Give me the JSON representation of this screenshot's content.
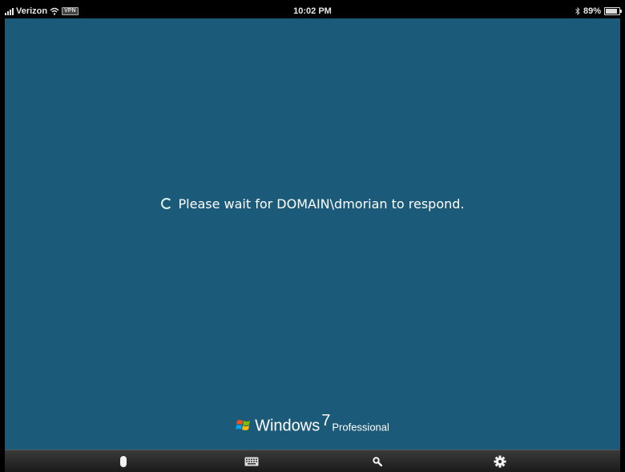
{
  "status_bar": {
    "carrier": "Verizon",
    "vpn_label": "VPN",
    "time": "10:02 PM",
    "battery": "89%",
    "battery_level": 0.89
  },
  "session": {
    "message": "Please wait for DOMAIN\\dmorian to respond."
  },
  "branding": {
    "name": "Windows",
    "version": "7",
    "edition": "Professional"
  },
  "toolbar": {
    "items": [
      {
        "icon": "mouse-icon"
      },
      {
        "icon": "keyboard-icon"
      },
      {
        "icon": "search-icon"
      },
      {
        "icon": "gear-icon"
      }
    ]
  },
  "colors": {
    "desktop_background": "#1b5b79",
    "text": "#ffffff"
  }
}
